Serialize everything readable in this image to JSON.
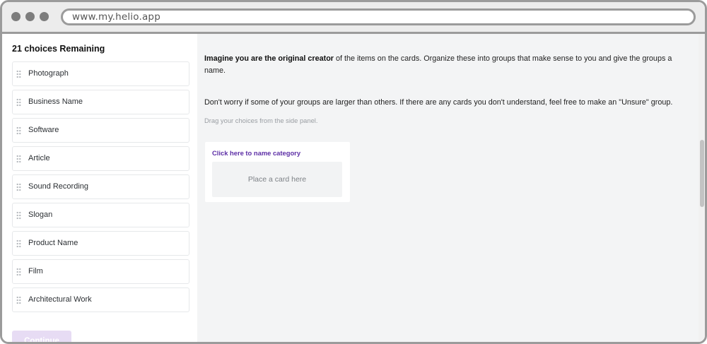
{
  "browser": {
    "url": "www.my.helio.app"
  },
  "side_panel": {
    "remaining_label": "21 choices Remaining",
    "choices": [
      {
        "label": "Photograph"
      },
      {
        "label": "Business Name"
      },
      {
        "label": "Software"
      },
      {
        "label": "Article"
      },
      {
        "label": "Sound Recording"
      },
      {
        "label": "Slogan"
      },
      {
        "label": "Product Name"
      },
      {
        "label": "Film"
      },
      {
        "label": "Architectural Work"
      }
    ],
    "continue_label": "Continue"
  },
  "main": {
    "instruction_bold": "Imagine you are the original creator",
    "instruction_rest": " of the items on the cards. Organize these into groups that make sense to you and give the groups a name.",
    "instruction_2": "Don't worry if some of your groups are larger than others. If there are any cards you don't understand, feel free to make an \"Unsure\" group.",
    "drag_hint": "Drag your choices from the side panel.",
    "category": {
      "name_prompt": "Click here to name category",
      "placeholder": "Place a card here"
    }
  },
  "colors": {
    "accent_purple": "#5d2fa6",
    "continue_disabled_bg": "#e7dcf4",
    "main_bg": "#f3f4f5"
  }
}
